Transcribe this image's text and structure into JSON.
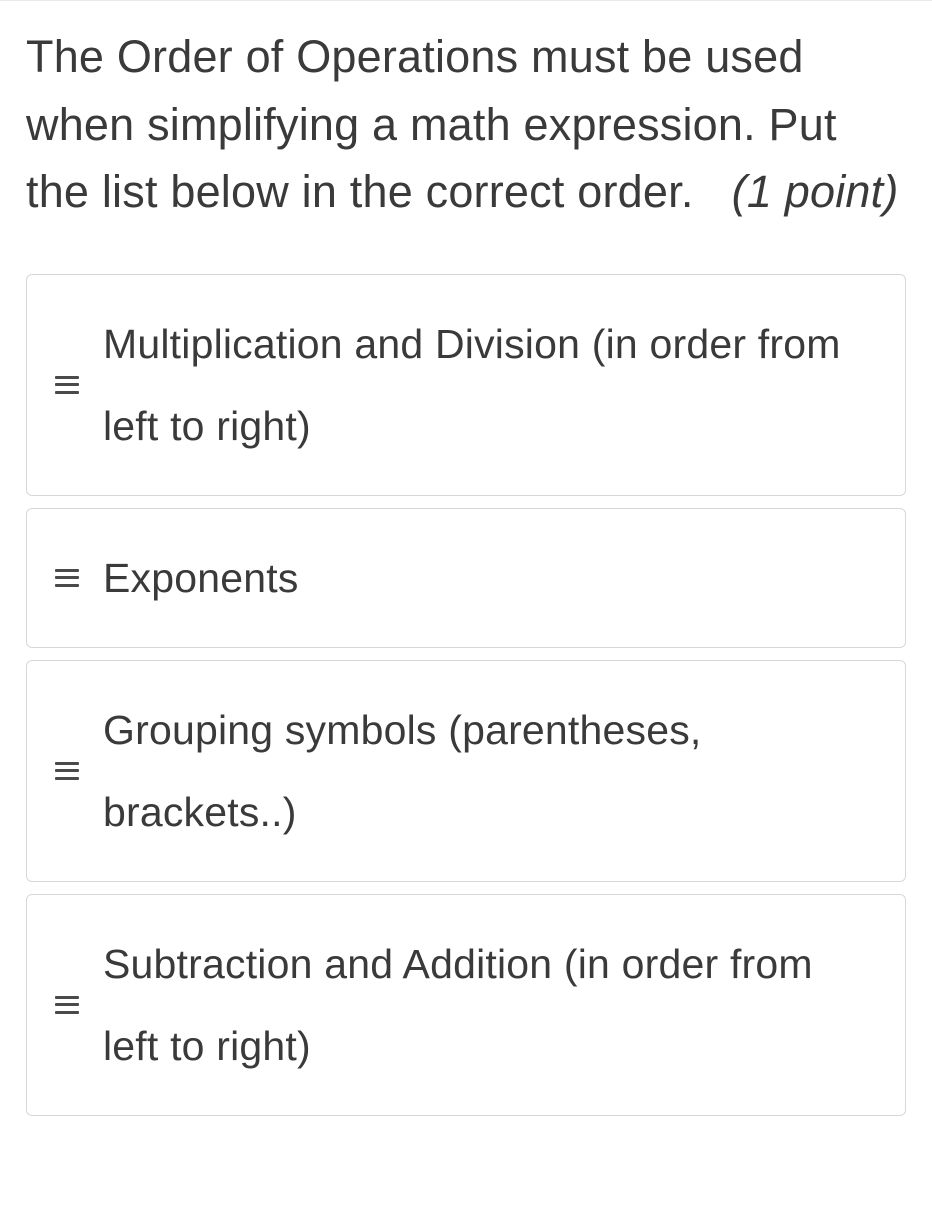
{
  "question": {
    "text": "The Order of Operations must be used when simplifying a math expression.  Put the list below in the correct order.",
    "points_label": "(1 point)"
  },
  "items": [
    {
      "label": "Multiplication and Division (in order from left to right)"
    },
    {
      "label": "Exponents"
    },
    {
      "label": "Grouping symbols (parentheses, brackets..)"
    },
    {
      "label": "Subtraction and Addition (in order from left to right)"
    }
  ]
}
